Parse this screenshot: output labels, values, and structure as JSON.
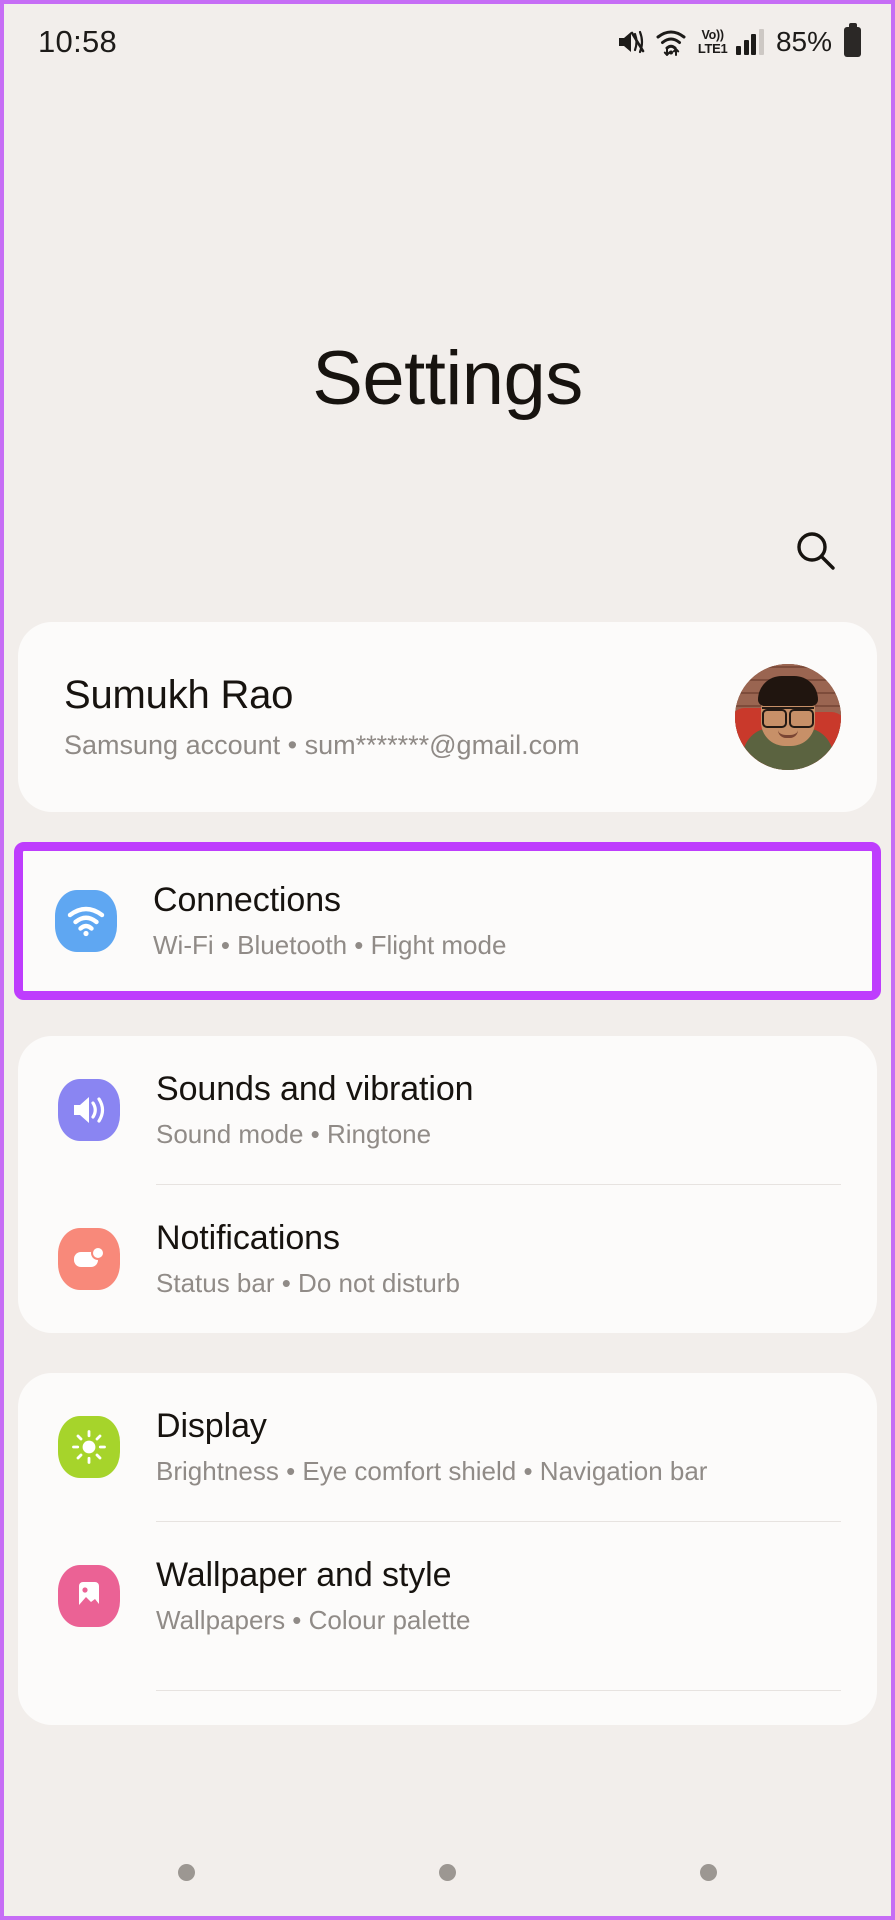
{
  "status_bar": {
    "clock": "10:58",
    "battery_percent": "85%",
    "network_top": "Vo))",
    "network_bottom": "LTE1",
    "icons": [
      "mute-icon",
      "wifi-icon",
      "volte-icon",
      "signal-icon",
      "battery-icon"
    ]
  },
  "header": {
    "title": "Settings",
    "search_icon": "search-icon"
  },
  "account": {
    "name": "Sumukh Rao",
    "subtitle": "Samsung account  •  sum*******@gmail.com",
    "avatar_alt": "Profile photo"
  },
  "groups": [
    {
      "highlighted": true,
      "items": [
        {
          "title": "Connections",
          "subtitle": "Wi-Fi  •  Bluetooth  •  Flight mode",
          "icon": "wifi-icon",
          "icon_color": "#5FA7F2"
        }
      ]
    },
    {
      "highlighted": false,
      "items": [
        {
          "title": "Sounds and vibration",
          "subtitle": "Sound mode  •  Ringtone",
          "icon": "speaker-icon",
          "icon_color": "#8A85F2"
        },
        {
          "title": "Notifications",
          "subtitle": "Status bar  •  Do not disturb",
          "icon": "notification-icon",
          "icon_color": "#F8897A"
        }
      ]
    },
    {
      "highlighted": false,
      "items": [
        {
          "title": "Display",
          "subtitle": "Brightness  •  Eye comfort shield  •  Navigation bar",
          "icon": "brightness-icon",
          "icon_color": "#A6D42B"
        },
        {
          "title": "Wallpaper and style",
          "subtitle": "Wallpapers  •  Colour palette",
          "icon": "image-icon",
          "icon_color": "#EB6295"
        }
      ]
    }
  ],
  "nav_bar": {
    "dots": [
      "recents-button",
      "home-button",
      "back-button"
    ]
  },
  "theme": {
    "background": "#F2EEEB",
    "card": "#FCFBFA",
    "highlight": "#BE3DFD",
    "title_text": "#17130f",
    "sub_text": "#908b87"
  }
}
